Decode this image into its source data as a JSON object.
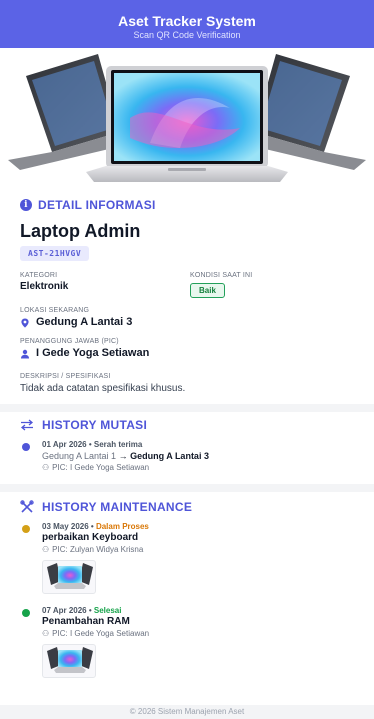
{
  "header": {
    "title": "Aset Tracker System",
    "subtitle": "Scan QR Code Verification"
  },
  "hero_image": {
    "alt": "laptop-photo"
  },
  "detail": {
    "section_title": "DETAIL INFORMASI",
    "asset_name": "Laptop Admin",
    "asset_code": "AST-21HVGV",
    "kategori_label": "KATEGORI",
    "kategori_value": "Elektronik",
    "kondisi_label": "KONDISI SAAT INI",
    "kondisi_value": "Baik",
    "lokasi_label": "LOKASI SEKARANG",
    "lokasi_value": "Gedung A Lantai 3",
    "pic_label": "PENANGGUNG JAWAB (PIC)",
    "pic_value": "I Gede Yoga Setiawan",
    "desc_label": "DESKRIPSI / SPESIFIKASI",
    "desc_value": "Tidak ada catatan spesifikasi khusus."
  },
  "mutasi": {
    "section_title": "HISTORY MUTASI",
    "items": [
      {
        "date": "01 Apr 2026",
        "type": "Serah terima",
        "from": "Gedung A Lantai 1",
        "arrow": "→",
        "to": "Gedung A Lantai 3",
        "pic": "PIC: I Gede Yoga Setiawan"
      }
    ]
  },
  "maintenance": {
    "section_title": "HISTORY MAINTENANCE",
    "items": [
      {
        "date": "03 May 2026",
        "status": "Dalam Proses",
        "title": "perbaikan Keyboard",
        "pic": "PIC: Zulyan Widya Krisna"
      },
      {
        "date": "07 Apr 2026",
        "status": "Selesai",
        "title": "Penambahan RAM",
        "pic": "PIC: I Gede Yoga Setiawan"
      }
    ]
  },
  "footer": {
    "text": "© 2026 Sistem Manajemen Aset"
  },
  "colors": {
    "accent": "#5b63e6",
    "status_proses": "#d97706",
    "status_selesai": "#16a34a",
    "good": "#22a05a"
  }
}
